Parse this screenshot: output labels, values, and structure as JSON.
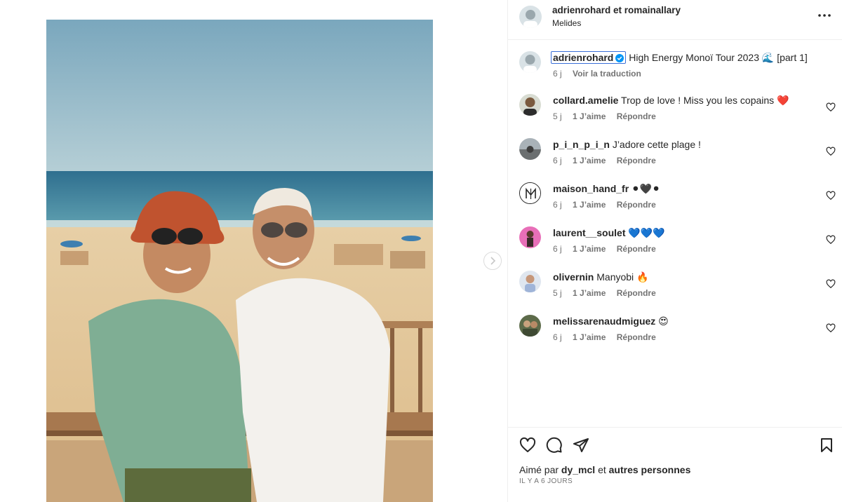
{
  "post": {
    "authors": "adrienrohard et romainallary",
    "location": "Melides",
    "caption": {
      "username": "adrienrohard",
      "text": "High Energy Monoï Tour 2023 🌊 [part 1]",
      "time": "6 j",
      "translate_label": "Voir la traduction"
    }
  },
  "comments": [
    {
      "username": "collard.amelie",
      "text": "Trop de love ! Miss you les copains ❤️",
      "time": "5 j",
      "likes": "1 J’aime",
      "reply": "Répondre",
      "avatar_color": "#7a5a3e"
    },
    {
      "username": "p_i_n_p_i_n",
      "text": "J’adore cette plage !",
      "time": "6 j",
      "likes": "1 J’aime",
      "reply": "Répondre",
      "avatar_color": "#8a8f96"
    },
    {
      "username": "maison_hand_fr",
      "text": "⚫🖤⚫",
      "time": "6 j",
      "likes": "1 J’aime",
      "reply": "Répondre",
      "avatar_color": "#ffffff"
    },
    {
      "username": "laurent__soulet",
      "text": "💙💙💙",
      "time": "6 j",
      "likes": "1 J’aime",
      "reply": "Répondre",
      "avatar_color": "#e86fb8"
    },
    {
      "username": "olivernin",
      "text": "Manyobi 🔥",
      "time": "5 j",
      "likes": "1 J’aime",
      "reply": "Répondre",
      "avatar_color": "#9fb4d8"
    },
    {
      "username": "melissarenaudmiguez",
      "text": "😍",
      "time": "6 j",
      "likes": "1 J’aime",
      "reply": "Répondre",
      "avatar_color": "#5d6b4a"
    }
  ],
  "actions": {
    "liked_by_prefix": "Aimé par",
    "liked_by_user": "dy_mcl",
    "liked_by_joiner": "et",
    "liked_by_suffix": "autres personnes",
    "time_ago": "IL Y A 6 JOURS"
  },
  "icons": {
    "like": "heart-icon",
    "comment": "comment-icon",
    "share": "paper-plane-icon",
    "save": "bookmark-icon",
    "more": "more-horizontal-icon",
    "next": "chevron-right-icon",
    "verified": "verified-badge-icon"
  },
  "colors": {
    "verified_blue": "#0095f6",
    "text_primary": "#262626",
    "text_secondary": "#737373",
    "focus_outline": "#3a6fd8"
  }
}
